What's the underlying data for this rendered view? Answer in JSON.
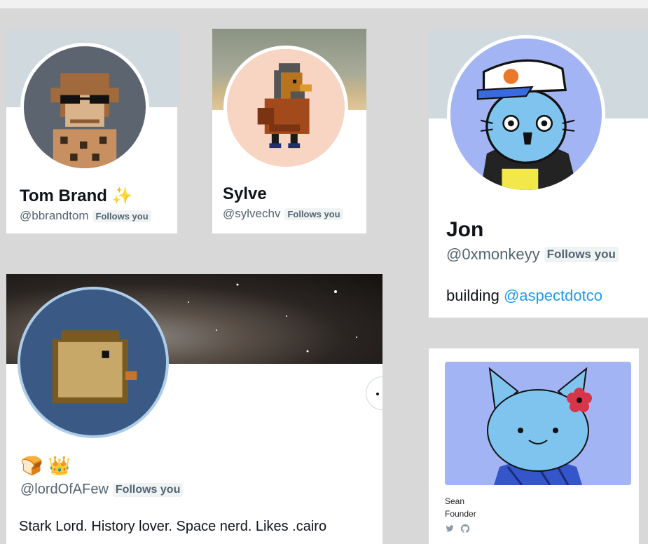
{
  "cards": {
    "tom": {
      "name": "Tom Brand",
      "emoji": "✨",
      "handle": "@bbrandtom",
      "badge": "Follows you"
    },
    "sylve": {
      "name": "Sylve",
      "handle": "@sylvechv",
      "badge": "Follows you"
    },
    "jon": {
      "name": "Jon",
      "handle": "@0xmonkeyy",
      "badge": "Follows you",
      "bio_prefix": "building ",
      "bio_link": "@aspectdotco"
    },
    "lord": {
      "emojis": "🍞 👑",
      "handle": "@lordOfAFew",
      "badge": "Follows you",
      "bio": "Stark Lord. History lover. Space nerd. Likes .cairo"
    },
    "sean": {
      "name": "Sean",
      "role": "Founder",
      "icons": [
        "twitter-icon",
        "github-icon"
      ]
    }
  },
  "colors": {
    "page_bg": "#d7d8d7",
    "card_bg": "#ffffff",
    "banner_gray": "#cfd9de",
    "handle_gray": "#536471",
    "link_blue": "#1d9bf0",
    "badge_bg": "#eff3f4",
    "avatar_tom_bg": "#5c6470",
    "avatar_sylve_bg": "#f8d4c3",
    "avatar_jon_bg": "#a3b4f4",
    "avatar_lord_bg": "#3a5a85",
    "avatar_sean_bg": "#a3b4f4"
  }
}
